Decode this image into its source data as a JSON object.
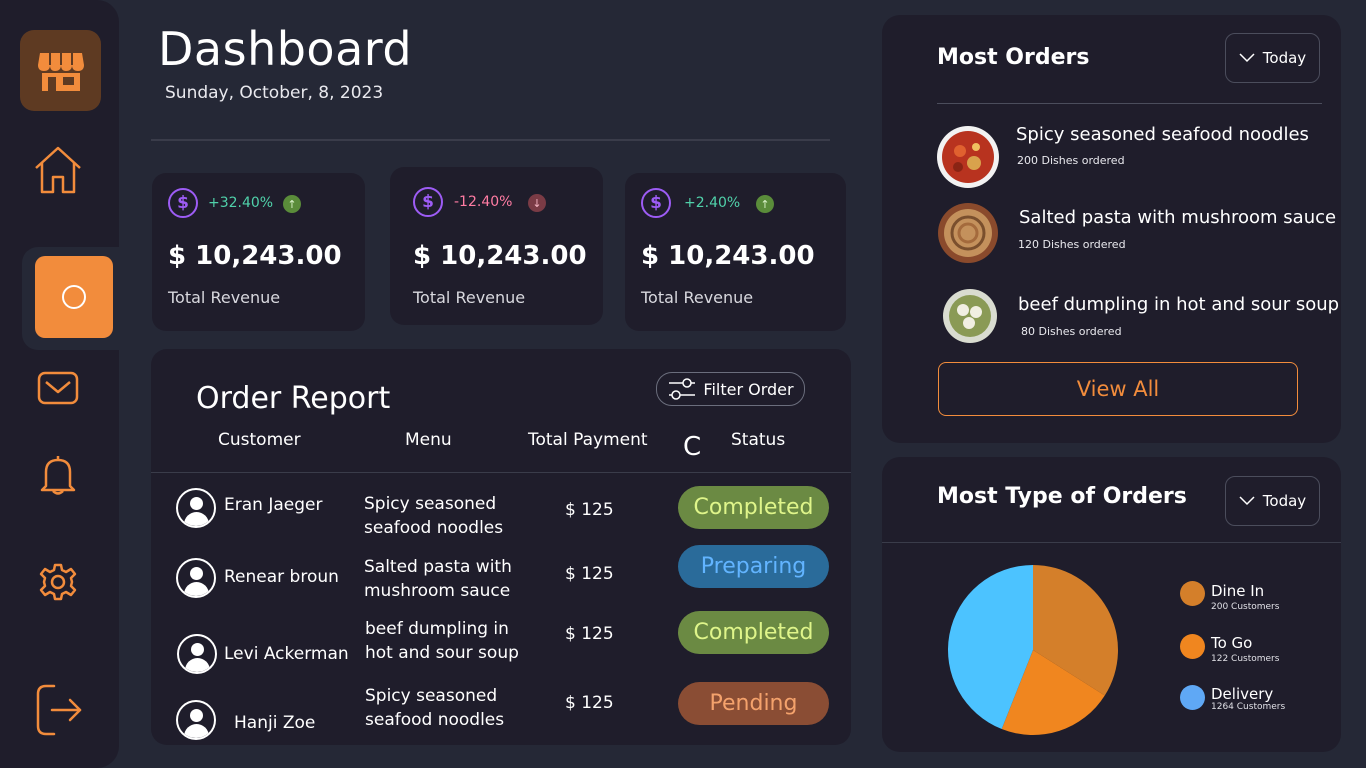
{
  "header": {
    "title": "Dashboard",
    "date": "Sunday, October, 8, 2023"
  },
  "sidebar": {
    "items": [
      {
        "name": "home",
        "icon": "home-icon"
      },
      {
        "name": "dashboard",
        "icon": "circle-icon",
        "active": true
      },
      {
        "name": "messages",
        "icon": "mail-icon"
      },
      {
        "name": "notifications",
        "icon": "bell-icon"
      },
      {
        "name": "settings",
        "icon": "gear-icon"
      },
      {
        "name": "logout",
        "icon": "logout-icon"
      }
    ]
  },
  "stats": [
    {
      "change": "+32.40%",
      "trend": "up",
      "amount": "$ 10,243.00",
      "label": "Total Revenue"
    },
    {
      "change": "-12.40%",
      "trend": "down",
      "amount": "$ 10,243.00",
      "label": "Total Revenue"
    },
    {
      "change": "+2.40%",
      "trend": "up",
      "amount": "$ 10,243.00",
      "label": "Total Revenue"
    }
  ],
  "order_report": {
    "title": "Order Report",
    "filter_label": "Filter Order",
    "columns": [
      "Customer",
      "Menu",
      "Total Payment",
      "Status"
    ],
    "stray_char": "C",
    "rows": [
      {
        "customer": "Eran Jaeger",
        "menu_line1": "Spicy seasoned",
        "menu_line2": "seafood noodles",
        "payment": "$ 125",
        "status": "Completed"
      },
      {
        "customer": "Renear broun",
        "menu_line1": "Salted pasta with",
        "menu_line2": "mushroom sauce",
        "payment": "$ 125",
        "status": "Preparing"
      },
      {
        "customer": "Levi Ackerman",
        "menu_line1": "beef dumpling in",
        "menu_line2": "hot and sour soup",
        "payment": "$ 125",
        "status": "Completed"
      },
      {
        "customer": "Hanji Zoe",
        "menu_line1": "Spicy seasoned",
        "menu_line2": "seafood noodles",
        "payment": "$ 125",
        "status": "Pending"
      }
    ]
  },
  "most_orders": {
    "title": "Most Orders",
    "period": "Today",
    "dishes": [
      {
        "name": "Spicy seasoned seafood noodles",
        "count": "200 Dishes ordered"
      },
      {
        "name": "Salted pasta with mushroom sauce",
        "count": "120 Dishes ordered"
      },
      {
        "name": "beef dumpling in hot and sour soup",
        "count": "80 Dishes ordered"
      }
    ],
    "view_all": "View All"
  },
  "most_type": {
    "title": "Most Type of Orders",
    "period": "Today",
    "legend": [
      {
        "name": "Dine In",
        "sub": "200 Customers",
        "color": "#d47f2a"
      },
      {
        "name": "To Go",
        "sub": "122 Customers",
        "color": "#f0861f"
      },
      {
        "name": "Delivery",
        "sub": "1264 Customers",
        "color": "#5fa8f5"
      }
    ]
  },
  "chart_data": {
    "type": "pie",
    "categories": [
      "Dine In",
      "To Go",
      "Delivery"
    ],
    "values": [
      200,
      122,
      1264
    ],
    "slice_shares": [
      0.34,
      0.22,
      0.44
    ],
    "colors": [
      "#d47f2a",
      "#f0861f",
      "#4cc3ff"
    ]
  },
  "colors": {
    "accent": "#f28c3c",
    "panel": "#1f1d2b",
    "background": "#252836",
    "positive": "#50d1aa",
    "negative": "#ff7ca3",
    "dollar_icon": "#9d5cf5"
  }
}
